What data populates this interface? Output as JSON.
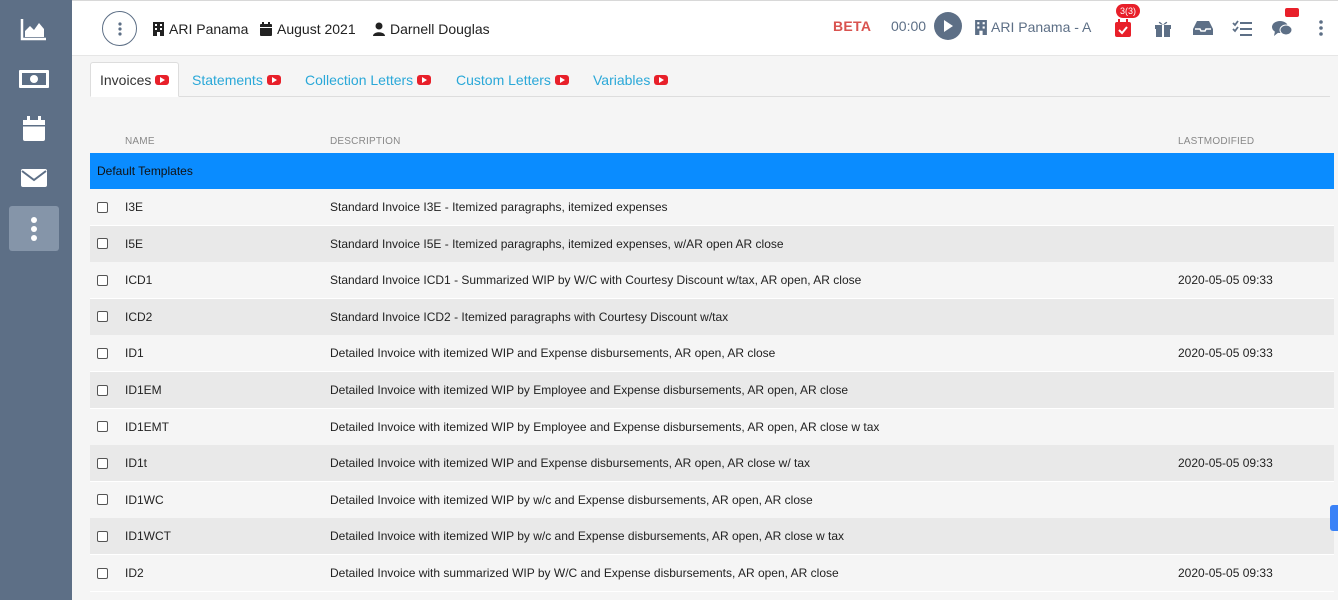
{
  "sidebar": {
    "items": [
      {
        "name": "chart-icon"
      },
      {
        "name": "money-icon"
      },
      {
        "name": "calendar-icon"
      },
      {
        "name": "envelope-icon"
      },
      {
        "name": "more-vertical-icon",
        "active": true
      }
    ]
  },
  "header": {
    "firm": "ARI Panama",
    "period": "August 2021",
    "user": "Darnell Douglas",
    "beta": "BETA",
    "timer": "00:00",
    "client": "ARI Panama - A",
    "tasks_badge": "3(3)"
  },
  "tabs": [
    {
      "label": "Invoices",
      "active": true
    },
    {
      "label": "Statements",
      "active": false
    },
    {
      "label": "Collection Letters",
      "active": false
    },
    {
      "label": "Custom Letters",
      "active": false
    },
    {
      "label": "Variables",
      "active": false
    }
  ],
  "table": {
    "columns": {
      "name": "NAME",
      "description": "DESCRIPTION",
      "modified": "LASTMODIFIED"
    },
    "group": "Default Templates",
    "rows": [
      {
        "name": "I3E",
        "description": "Standard Invoice I3E - Itemized paragraphs, itemized expenses",
        "modified": ""
      },
      {
        "name": "I5E",
        "description": "Standard Invoice I5E - Itemized paragraphs, itemized expenses, w/AR open AR close",
        "modified": ""
      },
      {
        "name": "ICD1",
        "description": "Standard Invoice ICD1 - Summarized WIP by W/C with Courtesy Discount w/tax, AR open, AR close",
        "modified": "2020-05-05 09:33"
      },
      {
        "name": "ICD2",
        "description": "Standard Invoice ICD2 - Itemized paragraphs with Courtesy Discount w/tax",
        "modified": ""
      },
      {
        "name": "ID1",
        "description": "Detailed Invoice with itemized WIP and Expense disbursements, AR open, AR close",
        "modified": "2020-05-05 09:33"
      },
      {
        "name": "ID1EM",
        "description": "Detailed Invoice with itemized WIP by Employee and Expense disbursements, AR open, AR close",
        "modified": ""
      },
      {
        "name": "ID1EMT",
        "description": "Detailed Invoice with itemized WIP by Employee and Expense disbursements, AR open, AR close w tax",
        "modified": ""
      },
      {
        "name": "ID1t",
        "description": "Detailed Invoice with itemized WIP and Expense disbursements, AR open, AR close w/ tax",
        "modified": "2020-05-05 09:33"
      },
      {
        "name": "ID1WC",
        "description": "Detailed Invoice with itemized WIP by w/c and Expense disbursements, AR open, AR close",
        "modified": ""
      },
      {
        "name": "ID1WCT",
        "description": "Detailed Invoice with itemized WIP by w/c and Expense disbursements, AR open, AR close w tax",
        "modified": ""
      },
      {
        "name": "ID2",
        "description": "Detailed Invoice with summarized WIP by W/C and Expense disbursements, AR open, AR close",
        "modified": "2020-05-05 09:33"
      }
    ]
  },
  "colors": {
    "sidebar": "#5d6f86",
    "accent": "#2aa8d8",
    "group_row": "#0a8cff",
    "beta": "#d9534f",
    "badge": "#e8202a"
  }
}
